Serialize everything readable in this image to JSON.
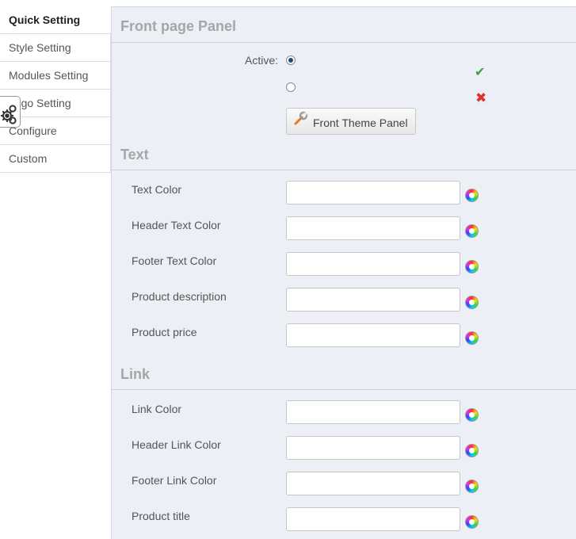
{
  "sidebar": {
    "tabs": [
      {
        "label": "Quick Setting",
        "active": true
      },
      {
        "label": "Style Setting",
        "active": false
      },
      {
        "label": "Modules Setting",
        "active": false
      },
      {
        "label": "Logo Setting",
        "active": false
      },
      {
        "label": "Configure",
        "active": false
      },
      {
        "label": "Custom",
        "active": false
      }
    ]
  },
  "front_panel": {
    "title": "Front page Panel",
    "active_label": "Active:",
    "active_value": "yes",
    "button_label": "Front Theme Panel",
    "colors": {
      "check": "#3ea33e",
      "cross": "#e0302a"
    }
  },
  "text_section": {
    "title": "Text",
    "fields": [
      {
        "label": "Text Color",
        "value": ""
      },
      {
        "label": "Header Text Color",
        "value": ""
      },
      {
        "label": "Footer Text Color",
        "value": ""
      },
      {
        "label": "Product description",
        "value": ""
      },
      {
        "label": "Product price",
        "value": ""
      }
    ]
  },
  "link_section": {
    "title": "Link",
    "fields": [
      {
        "label": "Link Color",
        "value": ""
      },
      {
        "label": "Header Link Color",
        "value": ""
      },
      {
        "label": "Footer Link Color",
        "value": ""
      },
      {
        "label": "Product title",
        "value": ""
      }
    ]
  },
  "icons": {
    "settings": "gears-icon",
    "button": "wrench-icon",
    "picker": "color-wheel-icon",
    "yes": "checkmark-icon",
    "no": "cross-icon"
  }
}
